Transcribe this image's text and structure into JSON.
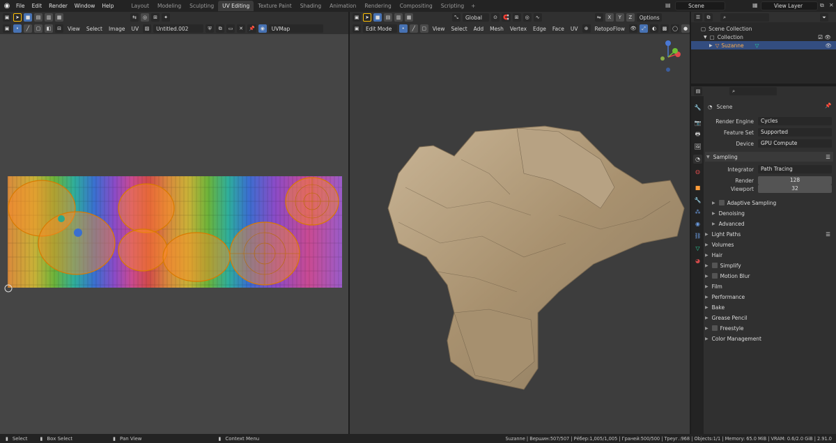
{
  "top_menu": [
    "File",
    "Edit",
    "Render",
    "Window",
    "Help"
  ],
  "workspace_tabs": [
    "Layout",
    "Modeling",
    "Sculpting",
    "UV Editing",
    "Texture Paint",
    "Shading",
    "Animation",
    "Rendering",
    "Compositing",
    "Scripting"
  ],
  "active_tab": "UV Editing",
  "scene": "Scene",
  "view_layer": "View Layer",
  "uv_header": {
    "menus": [
      "View",
      "Select",
      "Image",
      "UV"
    ],
    "image_name": "Untitled.002",
    "uv_map": "UVMap"
  },
  "viewport_header": {
    "mode": "Edit Mode",
    "menus": [
      "View",
      "Select",
      "Add",
      "Mesh",
      "Vertex",
      "Edge",
      "Face",
      "UV"
    ],
    "addon": "RetopoFlow",
    "orientation": "Global",
    "options": "Options",
    "axes": [
      "X",
      "Y",
      "Z"
    ]
  },
  "outliner": {
    "root": "Scene Collection",
    "collection": "Collection",
    "object": "Suzanne"
  },
  "properties": {
    "context": "Scene",
    "render_engine_label": "Render Engine",
    "render_engine": "Cycles",
    "feature_set_label": "Feature Set",
    "feature_set": "Supported",
    "device_label": "Device",
    "device": "GPU Compute",
    "sampling": "Sampling",
    "integrator_label": "Integrator",
    "integrator": "Path Tracing",
    "render_label": "Render",
    "render_samples": "128",
    "viewport_label": "Viewport",
    "viewport_samples": "32",
    "sub_panels": [
      "Adaptive Sampling",
      "Denoising",
      "Advanced"
    ],
    "panels": [
      "Light Paths",
      "Volumes",
      "Hair",
      "Simplify",
      "Motion Blur",
      "Film",
      "Performance",
      "Bake",
      "Grease Pencil",
      "Freestyle",
      "Color Management"
    ]
  },
  "status": {
    "select": "Select",
    "box_select": "Box Select",
    "pan_view": "Pan View",
    "context_menu": "Context Menu",
    "stats": "Suzanne | Вершин:507/507 | Рёбер:1,005/1,005 | Граней:500/500 | Треуг.:968 | Objects:1/1 | Memory: 65.0 MiB | VRAM: 0.6/2.0 GiB | 2.91.0"
  },
  "colors": {
    "accent": "#4772b3",
    "uv_edge": "#ff8c00",
    "area_bg": "#3d3d3d"
  }
}
